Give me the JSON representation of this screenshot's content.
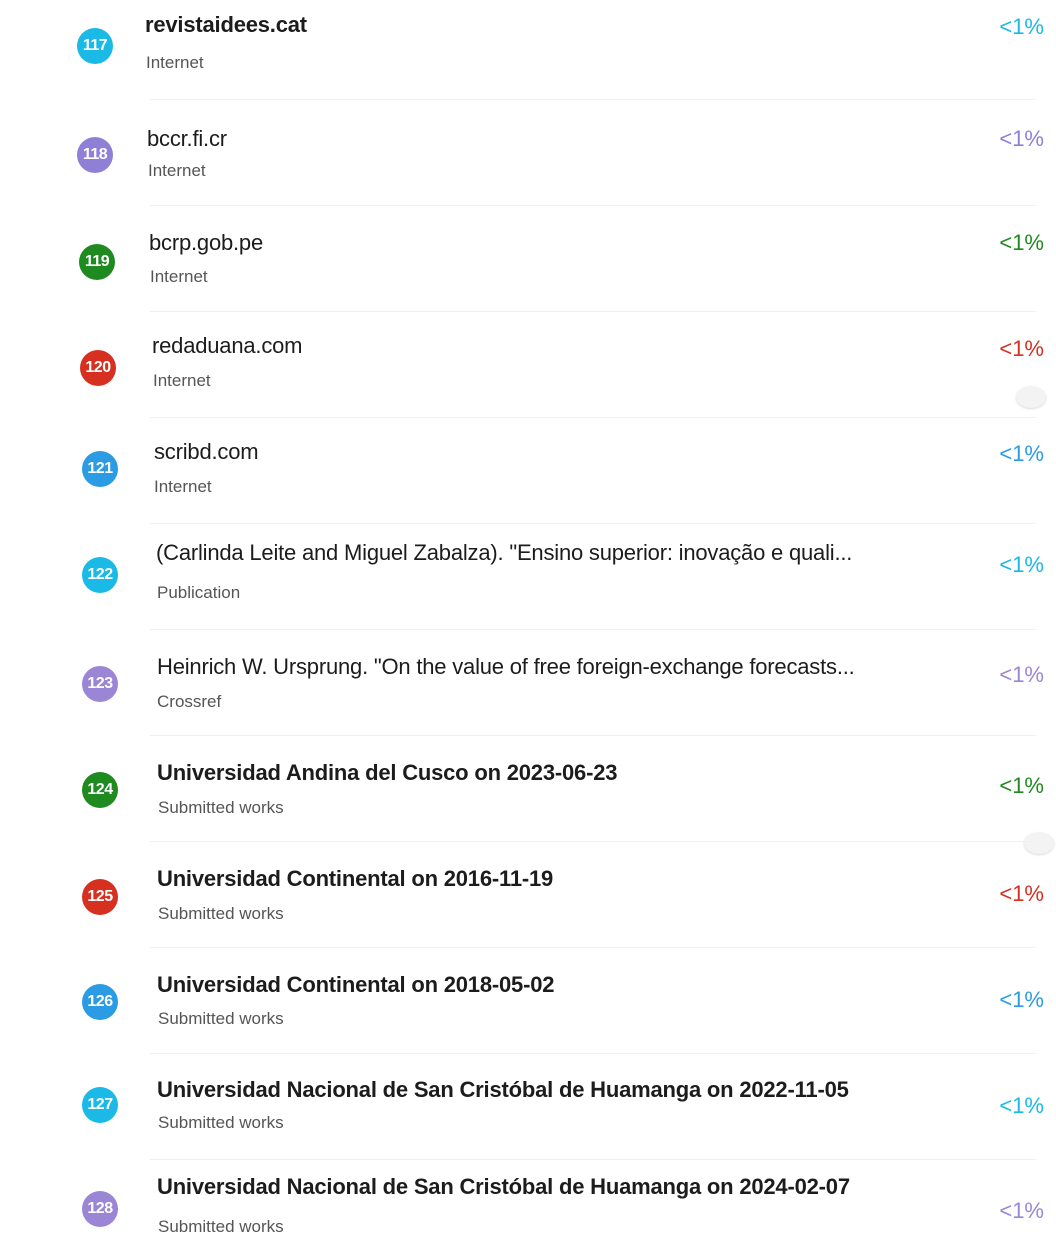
{
  "matches": [
    {
      "number": "117",
      "title": "revistaidees.cat",
      "type": "Internet",
      "percent": "<1%",
      "color": "#1ab9e6"
    },
    {
      "number": "118",
      "title": "bccr.fi.cr",
      "type": "Internet",
      "percent": "<1%",
      "color": "#8f7fd6"
    },
    {
      "number": "119",
      "title": "bcrp.gob.pe",
      "type": "Internet",
      "percent": "<1%",
      "color": "#1f8a1f"
    },
    {
      "number": "120",
      "title": "redaduana.com",
      "type": "Internet",
      "percent": "<1%",
      "color": "#d63020"
    },
    {
      "number": "121",
      "title": "scribd.com",
      "type": "Internet",
      "percent": "<1%",
      "color": "#2b9be3"
    },
    {
      "number": "122",
      "title": "(Carlinda Leite and Miguel Zabalza). \"Ensino superior: inovação e quali...",
      "type": "Publication",
      "percent": "<1%",
      "color": "#1ab9e6"
    },
    {
      "number": "123",
      "title": "Heinrich W. Ursprung. \"On the value of free foreign-exchange forecasts...",
      "type": "Crossref",
      "percent": "<1%",
      "color": "#9b86d6"
    },
    {
      "number": "124",
      "title": "Universidad Andina del Cusco on 2023-06-23",
      "type": "Submitted works",
      "percent": "<1%",
      "color": "#1f8a1f"
    },
    {
      "number": "125",
      "title": "Universidad Continental on 2016-11-19",
      "type": "Submitted works",
      "percent": "<1%",
      "color": "#d63020"
    },
    {
      "number": "126",
      "title": "Universidad Continental on 2018-05-02",
      "type": "Submitted works",
      "percent": "<1%",
      "color": "#2b9be3"
    },
    {
      "number": "127",
      "title": "Universidad Nacional de San Cristóbal de Huamanga on 2022-11-05",
      "type": "Submitted works",
      "percent": "<1%",
      "color": "#1ab9e6"
    },
    {
      "number": "128",
      "title": "Universidad Nacional de San Cristóbal de Huamanga on 2024-02-07",
      "type": "Submitted works",
      "percent": "<1%",
      "color": "#9b86d6"
    }
  ],
  "percent_colors": [
    "#1ab9e6",
    "#8f7fd6",
    "#1f8a1f",
    "#d63020",
    "#2b9be3",
    "#1ab9e6",
    "#9b86d6",
    "#1f8a1f",
    "#d63020",
    "#2b9be3",
    "#1ab9e6",
    "#9b86d6"
  ]
}
